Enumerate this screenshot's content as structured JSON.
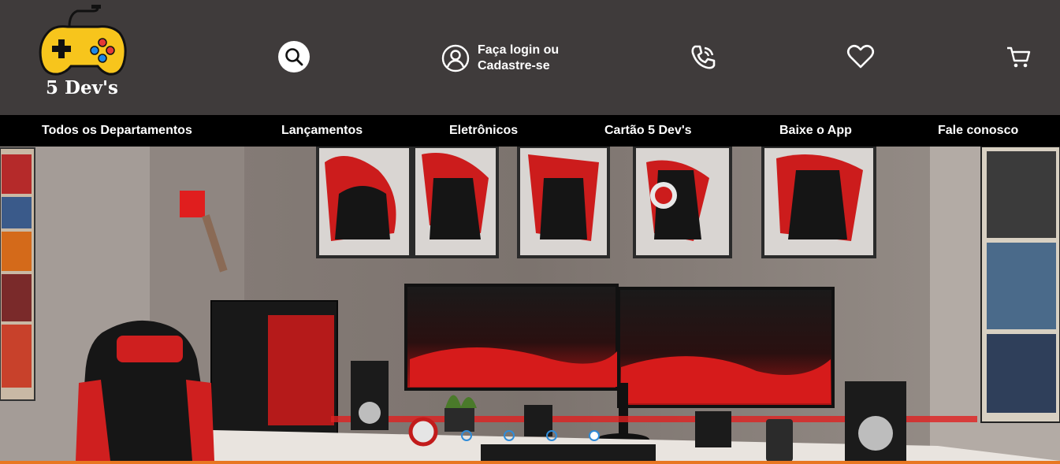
{
  "brand": {
    "name": "5 Dev's"
  },
  "header": {
    "login_line1": "Faça login ou",
    "login_line2": "Cadastre-se"
  },
  "nav": {
    "items": [
      {
        "label": "Todos os Departamentos"
      },
      {
        "label": "Lançamentos"
      },
      {
        "label": "Eletrônicos"
      },
      {
        "label": "Cartão 5 Dev's"
      },
      {
        "label": "Baixe o App"
      },
      {
        "label": "Fale conosco"
      }
    ]
  },
  "hero": {
    "theme_colors": {
      "accent_red": "#d81f1f",
      "wall": "#7a716d",
      "desk": "#e9e4df"
    },
    "slides_count": 4,
    "active_slide": 4
  },
  "colors": {
    "header_bg": "#3f3b3b",
    "nav_bg": "#000000",
    "bottom_bar": "#e87722",
    "dot_border": "#2f8bd8"
  },
  "icons": {
    "logo": "gamepad-icon",
    "search": "search-icon",
    "user": "user-circle-icon",
    "phone": "phone-icon",
    "favorites": "heart-icon",
    "cart": "cart-icon"
  }
}
